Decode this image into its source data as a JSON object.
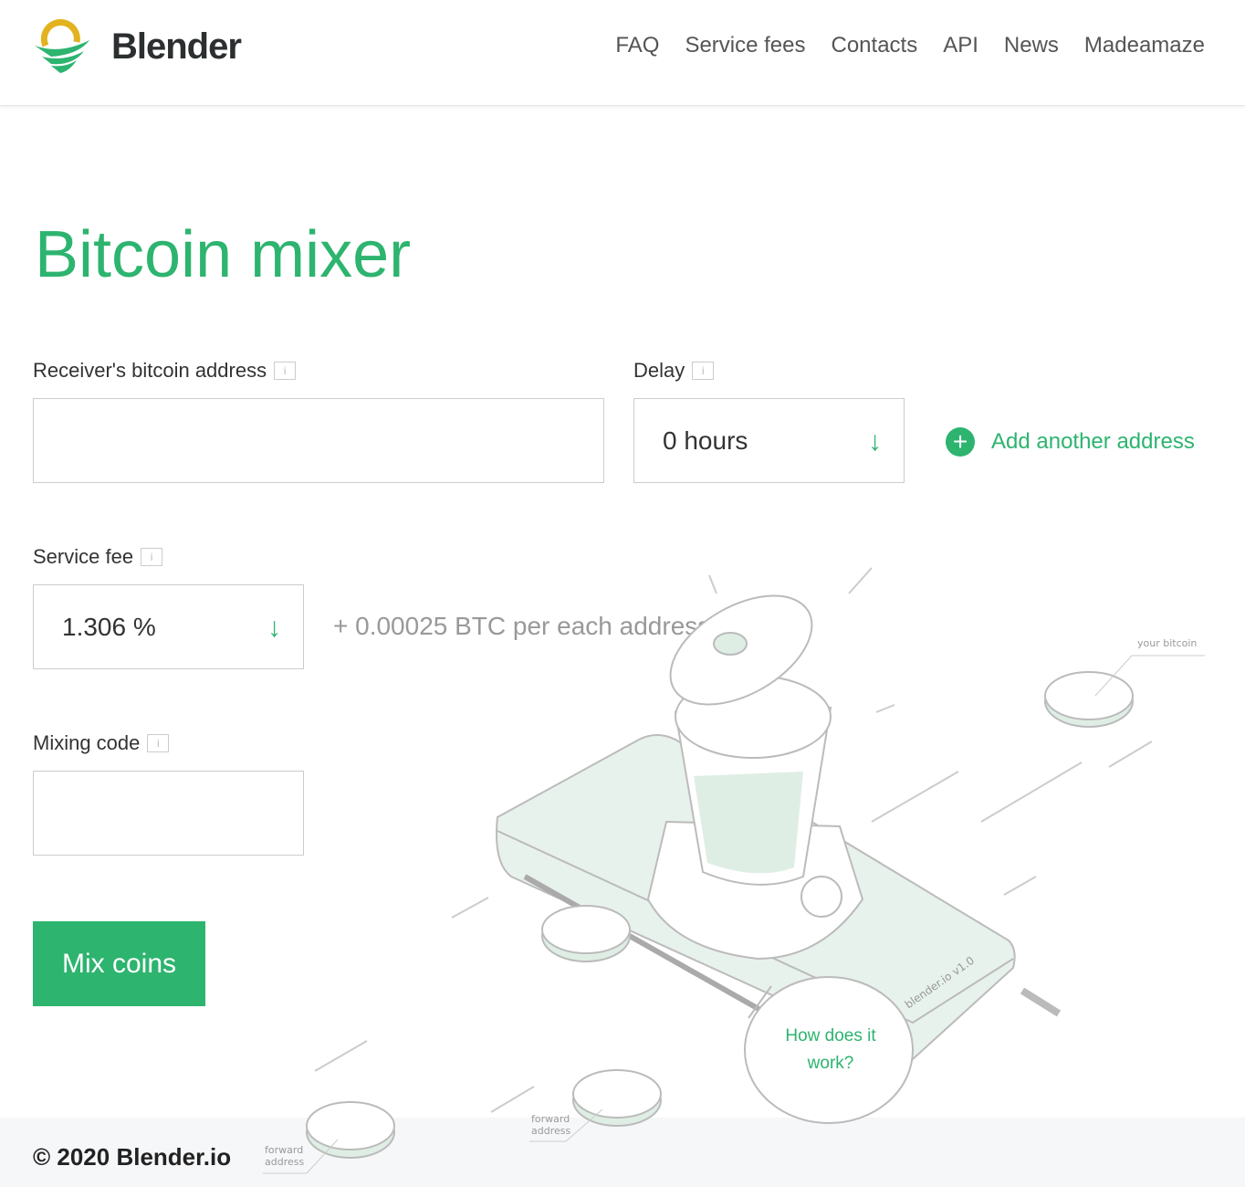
{
  "header": {
    "logo": "Blender",
    "nav": [
      "FAQ",
      "Service fees",
      "Contacts",
      "API",
      "News",
      "Madeamaze"
    ]
  },
  "page_title": "Bitcoin mixer",
  "form": {
    "receiver_label": "Receiver's bitcoin address",
    "receiver_value": "",
    "delay_label": "Delay",
    "delay_value": "0 hours",
    "add_address": "Add another address",
    "fee_label": "Service fee",
    "fee_value": "1.306 %",
    "fee_extra": "+ 0.00025 BTC per each address",
    "code_label": "Mixing code",
    "code_value": "",
    "submit": "Mix coins"
  },
  "illustration": {
    "your_bitcoin": "your bitcoin",
    "forward_address": "forward address",
    "device_label": "blender.io v1.0",
    "how": "How does it work?"
  },
  "footer": {
    "copyright": "© 2020 Blender.io"
  },
  "colors": {
    "accent": "#2db46f"
  }
}
